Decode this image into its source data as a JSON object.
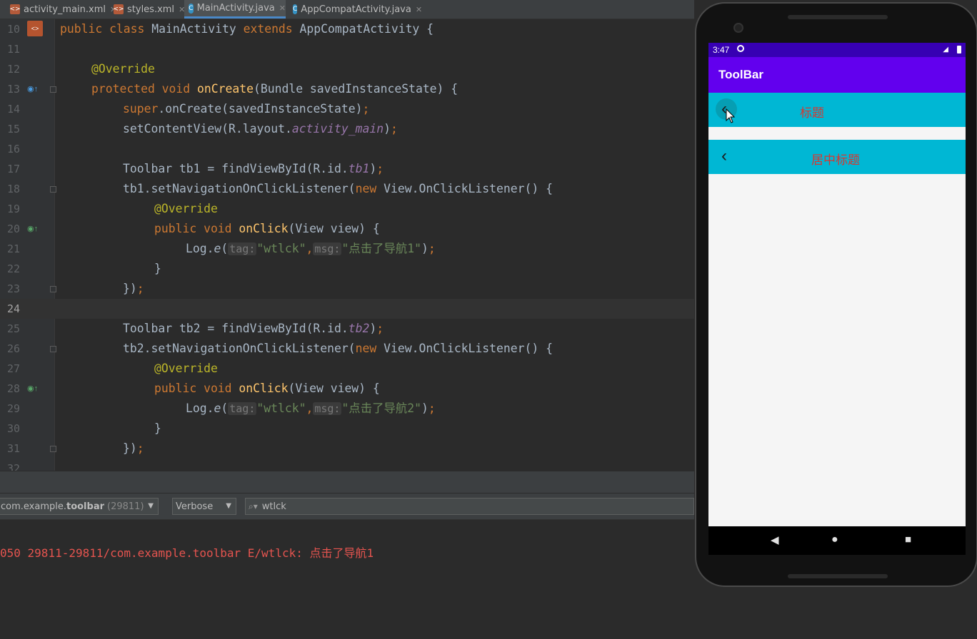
{
  "tabs": [
    {
      "label": "activity_main.xml",
      "type": "xml",
      "active": false
    },
    {
      "label": "styles.xml",
      "type": "xml",
      "active": false
    },
    {
      "label": "MainActivity.java",
      "type": "java",
      "active": true
    },
    {
      "label": "AppCompatActivity.java",
      "type": "java",
      "active": false
    }
  ],
  "editor": {
    "line_numbers": [
      "10",
      "11",
      "12",
      "13",
      "14",
      "15",
      "16",
      "17",
      "18",
      "19",
      "20",
      "21",
      "22",
      "23",
      "24",
      "25",
      "26",
      "27",
      "28",
      "29",
      "30",
      "31",
      "32"
    ],
    "current_line": "24",
    "code": {
      "l10": {
        "a": "public class ",
        "b": "MainActivity ",
        "c": "extends ",
        "d": "AppCompatActivity {"
      },
      "l12": "@Override",
      "l13": {
        "a": "protected void ",
        "b": "onCreate",
        "c": "(Bundle savedInstanceState) {"
      },
      "l14": {
        "a": "super",
        "b": ".onCreate(savedInstanceState)",
        "c": ";"
      },
      "l15": {
        "a": "setContentView(R.layout.",
        "b": "activity_main",
        "c": ")",
        "d": ";"
      },
      "l17": {
        "a": "Toolbar tb1 = findViewById(R.id.",
        "b": "tb1",
        "c": ")",
        "d": ";"
      },
      "l18": {
        "a": "tb1.setNavigationOnClickListener(",
        "b": "new ",
        "c": "View.OnClickListener() {"
      },
      "l19": "@Override",
      "l20": {
        "a": "public void ",
        "b": "onClick",
        "c": "(View view) {"
      },
      "l21": {
        "a": "Log.",
        "b": "e",
        "c": "(",
        "hint1": "tag:",
        "s1": "\"wtlck\"",
        "comma": ",",
        "hint2": "msg:",
        "s2": "\"点击了导航1\"",
        "end": ")",
        "semi": ";"
      },
      "l22": "}",
      "l23": {
        "a": "})",
        "b": ";"
      },
      "l25": {
        "a": "Toolbar tb2 = findViewById(R.id.",
        "b": "tb2",
        "c": ")",
        "d": ";"
      },
      "l26": {
        "a": "tb2.setNavigationOnClickListener(",
        "b": "new ",
        "c": "View.OnClickListener() {"
      },
      "l27": "@Override",
      "l28": {
        "a": "public void ",
        "b": "onClick",
        "c": "(View view) {"
      },
      "l29": {
        "a": "Log.",
        "b": "e",
        "c": "(",
        "hint1": "tag:",
        "s1": "\"wtlck\"",
        "comma": ",",
        "hint2": "msg:",
        "s2": "\"点击了导航2\"",
        "end": ")",
        "semi": ";"
      },
      "l30": "}",
      "l31": {
        "a": "})",
        "b": ";"
      }
    }
  },
  "logcat": {
    "process_prefix": "com.example.",
    "process_bold": "toolbar",
    "process_pid": "(29811)",
    "level": "Verbose",
    "search_value": "wtlck",
    "log_line": "050 29811-29811/com.example.toolbar E/wtlck: 点击了导航1"
  },
  "phone": {
    "time": "3:47",
    "app_title": "ToolBar",
    "toolbar1_title": "标题",
    "toolbar2_title": "居中标题",
    "nav_back": "‹",
    "nav_buttons": [
      "◀",
      "●",
      "■"
    ]
  },
  "colors": {
    "status_bar": "#3700b3",
    "app_bar": "#6200ee",
    "toolbar": "#00b7d4",
    "toolbar_text": "#d9362f",
    "log_error": "#e5544f"
  }
}
